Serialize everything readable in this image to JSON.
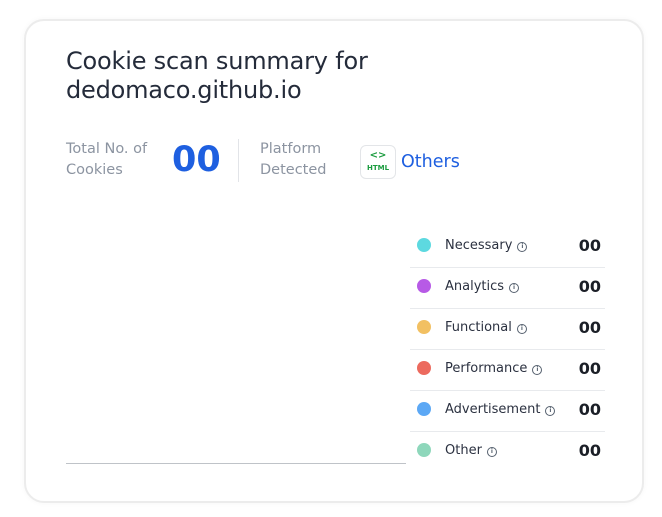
{
  "card": {
    "title": "Cookie scan summary for dedomaco.github.io",
    "total_label": "Total No. of Cookies",
    "total_value": "00",
    "platform_label": "Platform Detected",
    "platform_badge": {
      "code": "<>",
      "text": "HTML"
    },
    "platform_value": "Others"
  },
  "legend": [
    {
      "label": "Necessary",
      "count": "00",
      "color": "#5dd9e0"
    },
    {
      "label": "Analytics",
      "count": "00",
      "color": "#b75ae6"
    },
    {
      "label": "Functional",
      "count": "00",
      "color": "#f2c062"
    },
    {
      "label": "Performance",
      "count": "00",
      "color": "#ec6a5e"
    },
    {
      "label": "Advertisement",
      "count": "00",
      "color": "#5ca8f5"
    },
    {
      "label": "Other",
      "count": "00",
      "color": "#8ed7bb"
    }
  ],
  "info_glyph": "i"
}
